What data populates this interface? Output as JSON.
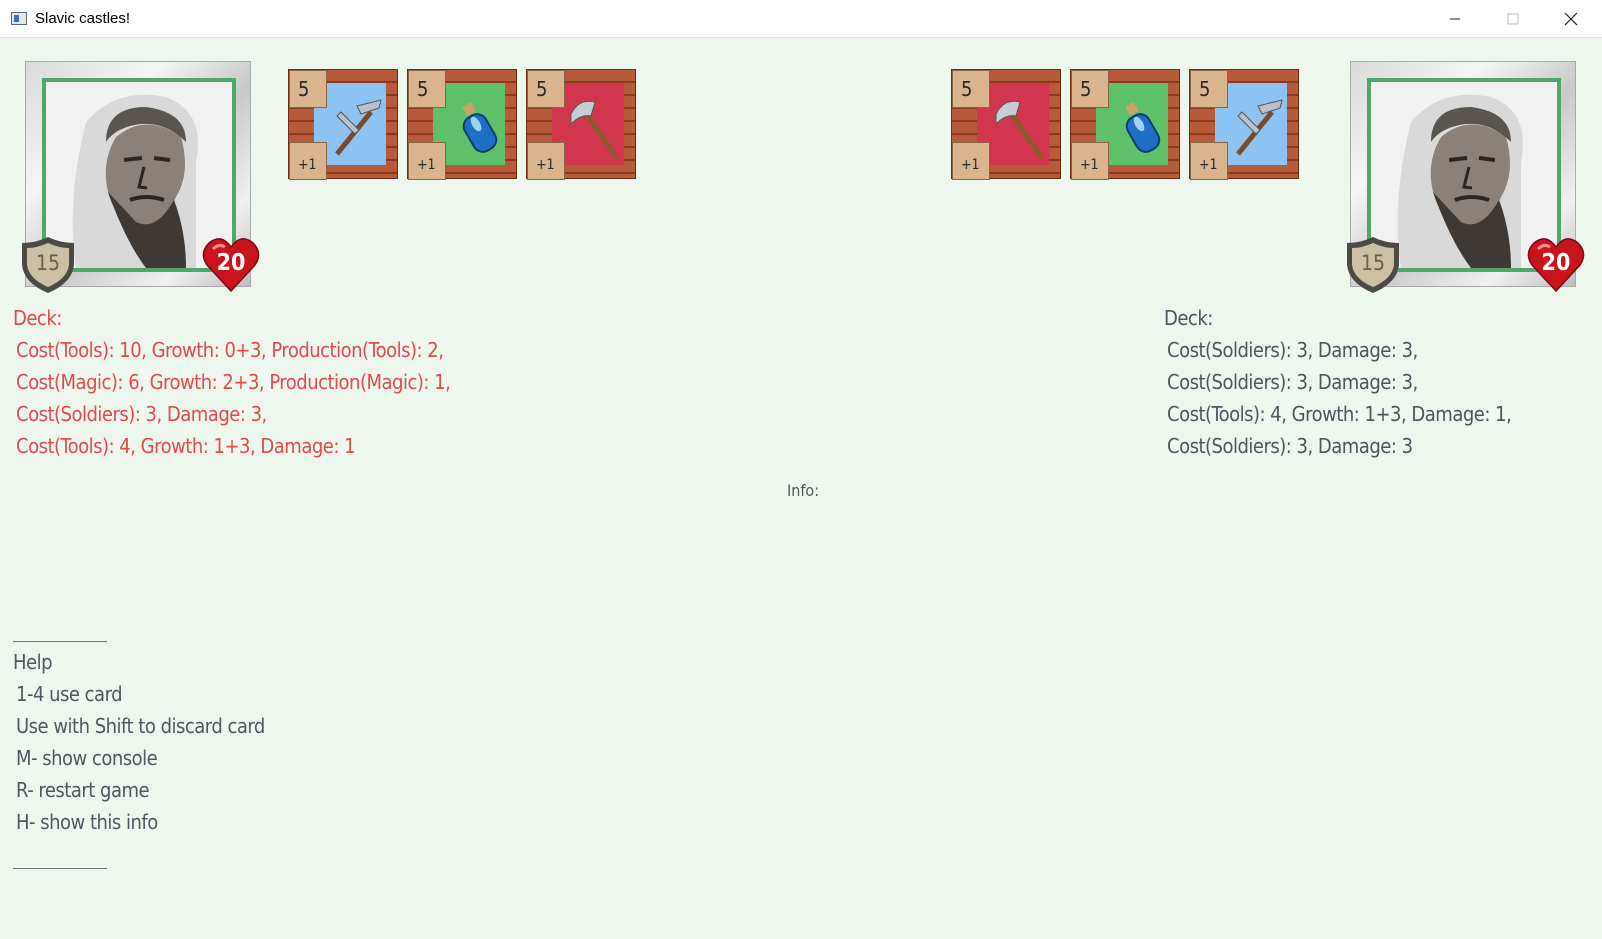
{
  "window": {
    "title": "Slavic castles!"
  },
  "player_left": {
    "armor": "15",
    "health": "20"
  },
  "player_right": {
    "armor": "15",
    "health": "20"
  },
  "cards_left": [
    {
      "cost": "5",
      "bonus": "+1",
      "color": "#8cc3f2",
      "icon": "hammer-pick-icon"
    },
    {
      "cost": "5",
      "bonus": "+1",
      "color": "#5fc06a",
      "icon": "potion-icon"
    },
    {
      "cost": "5",
      "bonus": "+1",
      "color": "#d2364e",
      "icon": "axe-icon"
    }
  ],
  "cards_right": [
    {
      "cost": "5",
      "bonus": "+1",
      "color": "#d2364e",
      "icon": "axe-icon"
    },
    {
      "cost": "5",
      "bonus": "+1",
      "color": "#5fc06a",
      "icon": "potion-icon"
    },
    {
      "cost": "5",
      "bonus": "+1",
      "color": "#8cc3f2",
      "icon": "hammer-pick-icon"
    }
  ],
  "deck_left": {
    "heading": "Deck:",
    "lines": [
      "Cost(Tools): 10, Growth: 0+3, Production(Tools): 2,",
      "Cost(Magic): 6, Growth: 2+3, Production(Magic): 1,",
      "Cost(Soldiers): 3, Damage: 3,",
      "Cost(Tools): 4, Growth: 1+3, Damage: 1"
    ]
  },
  "deck_right": {
    "heading": "Deck:",
    "lines": [
      "Cost(Soldiers): 3, Damage: 3,",
      "Cost(Soldiers): 3, Damage: 3,",
      "Cost(Tools): 4, Growth: 1+3, Damage: 1,",
      "Cost(Soldiers): 3, Damage: 3"
    ]
  },
  "info": {
    "label": "Info:"
  },
  "help": {
    "separator": "___________",
    "title": "Help",
    "lines": [
      "1-4 use card",
      "Use with Shift to discard card",
      "M- show console",
      "R- restart game",
      "H- show this info"
    ]
  }
}
